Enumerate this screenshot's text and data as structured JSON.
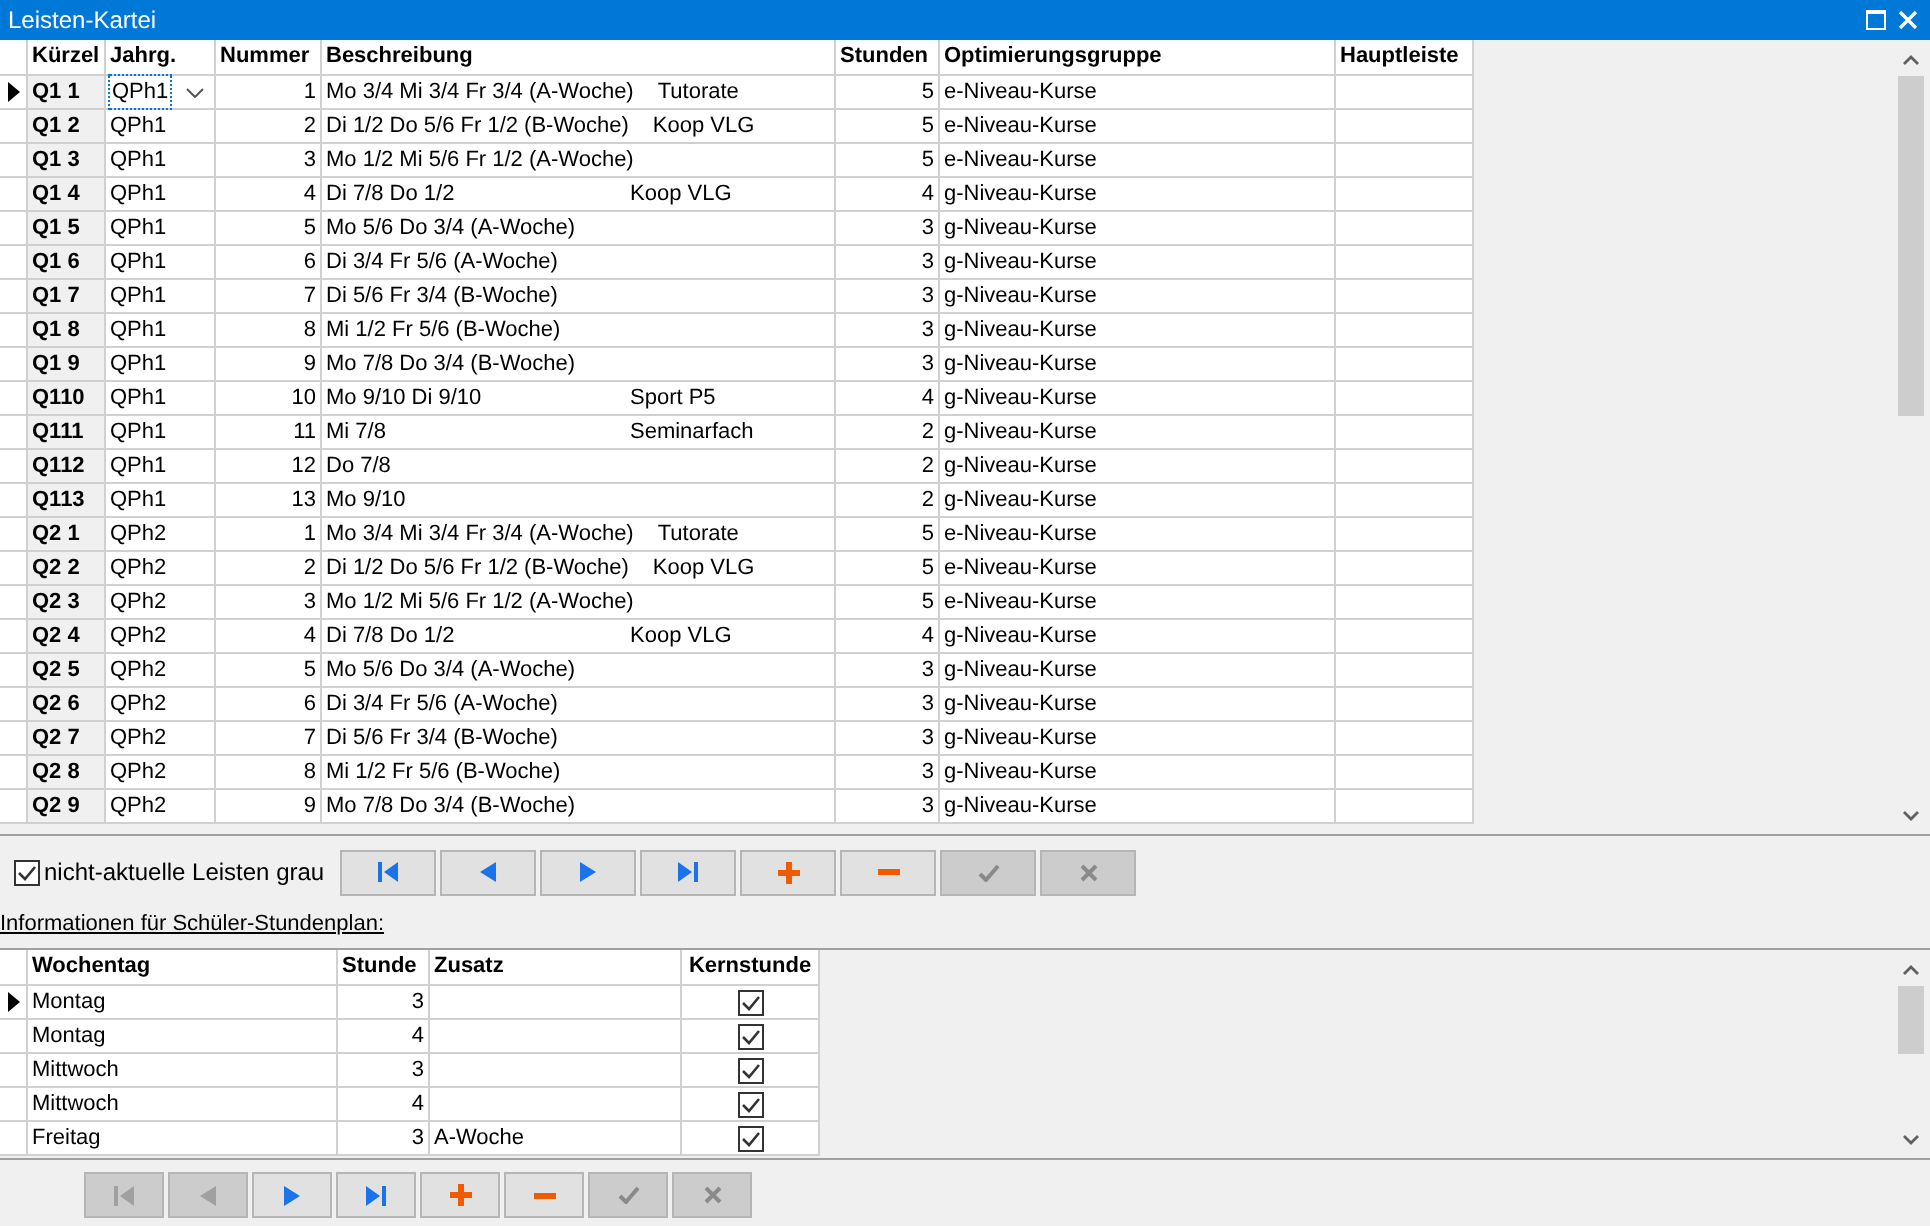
{
  "window": {
    "title": "Leisten-Kartei"
  },
  "leisten_table": {
    "columns": [
      "Kürzel",
      "Jahrg.",
      "Nummer",
      "Beschreibung",
      "Stunden",
      "Optimierungsgruppe",
      "Hauptleiste"
    ],
    "rows": [
      {
        "selected": true,
        "kuerzel": "Q1 1",
        "jahrg": "QPh1",
        "nummer": "1",
        "beschreibung": "Mo 3/4 Mi 3/4 Fr 3/4 (A-Woche)",
        "zusatz": "Tutorate",
        "stunden": "5",
        "gruppe": "e-Niveau-Kurse"
      },
      {
        "selected": false,
        "kuerzel": "Q1 2",
        "jahrg": "QPh1",
        "nummer": "2",
        "beschreibung": "Di 1/2 Do 5/6 Fr 1/2 (B-Woche)",
        "zusatz": "Koop VLG",
        "stunden": "5",
        "gruppe": "e-Niveau-Kurse"
      },
      {
        "selected": false,
        "kuerzel": "Q1 3",
        "jahrg": "QPh1",
        "nummer": "3",
        "beschreibung": "Mo 1/2 Mi 5/6 Fr 1/2 (A-Woche)",
        "stunden": "5",
        "gruppe": "e-Niveau-Kurse"
      },
      {
        "selected": false,
        "kuerzel": "Q1 4",
        "jahrg": "QPh1",
        "nummer": "4",
        "beschreibung": "Di 7/8 Do 1/2",
        "zusatz": "Koop VLG",
        "stunden": "4",
        "gruppe": "g-Niveau-Kurse"
      },
      {
        "selected": false,
        "kuerzel": "Q1 5",
        "jahrg": "QPh1",
        "nummer": "5",
        "beschreibung": "Mo 5/6 Do 3/4 (A-Woche)",
        "stunden": "3",
        "gruppe": "g-Niveau-Kurse"
      },
      {
        "selected": false,
        "kuerzel": "Q1 6",
        "jahrg": "QPh1",
        "nummer": "6",
        "beschreibung": "Di 3/4 Fr 5/6 (A-Woche)",
        "stunden": "3",
        "gruppe": "g-Niveau-Kurse"
      },
      {
        "selected": false,
        "kuerzel": "Q1 7",
        "jahrg": "QPh1",
        "nummer": "7",
        "beschreibung": "Di 5/6 Fr 3/4 (B-Woche)",
        "stunden": "3",
        "gruppe": "g-Niveau-Kurse"
      },
      {
        "selected": false,
        "kuerzel": "Q1 8",
        "jahrg": "QPh1",
        "nummer": "8",
        "beschreibung": "Mi 1/2 Fr 5/6 (B-Woche)",
        "stunden": "3",
        "gruppe": "g-Niveau-Kurse"
      },
      {
        "selected": false,
        "kuerzel": "Q1 9",
        "jahrg": "QPh1",
        "nummer": "9",
        "beschreibung": "Mo 7/8 Do 3/4 (B-Woche)",
        "stunden": "3",
        "gruppe": "g-Niveau-Kurse"
      },
      {
        "selected": false,
        "kuerzel": "Q110",
        "jahrg": "QPh1",
        "nummer": "10",
        "beschreibung": "Mo 9/10 Di 9/10",
        "zusatz": "Sport P5",
        "stunden": "4",
        "gruppe": "g-Niveau-Kurse"
      },
      {
        "selected": false,
        "kuerzel": "Q111",
        "jahrg": "QPh1",
        "nummer": "11",
        "beschreibung": "Mi 7/8",
        "zusatz": "Seminarfach",
        "stunden": "2",
        "gruppe": "g-Niveau-Kurse"
      },
      {
        "selected": false,
        "kuerzel": "Q112",
        "jahrg": "QPh1",
        "nummer": "12",
        "beschreibung": "Do 7/8",
        "stunden": "2",
        "gruppe": "g-Niveau-Kurse"
      },
      {
        "selected": false,
        "kuerzel": "Q113",
        "jahrg": "QPh1",
        "nummer": "13",
        "beschreibung": "Mo 9/10",
        "stunden": "2",
        "gruppe": "g-Niveau-Kurse"
      },
      {
        "selected": false,
        "kuerzel": "Q2 1",
        "jahrg": "QPh2",
        "nummer": "1",
        "beschreibung": "Mo 3/4 Mi 3/4 Fr 3/4 (A-Woche)",
        "zusatz": "Tutorate",
        "stunden": "5",
        "gruppe": "e-Niveau-Kurse"
      },
      {
        "selected": false,
        "kuerzel": "Q2 2",
        "jahrg": "QPh2",
        "nummer": "2",
        "beschreibung": "Di 1/2 Do 5/6 Fr 1/2 (B-Woche)",
        "zusatz": "Koop VLG",
        "stunden": "5",
        "gruppe": "e-Niveau-Kurse"
      },
      {
        "selected": false,
        "kuerzel": "Q2 3",
        "jahrg": "QPh2",
        "nummer": "3",
        "beschreibung": "Mo 1/2 Mi 5/6 Fr 1/2 (A-Woche)",
        "stunden": "5",
        "gruppe": "e-Niveau-Kurse"
      },
      {
        "selected": false,
        "kuerzel": "Q2 4",
        "jahrg": "QPh2",
        "nummer": "4",
        "beschreibung": "Di 7/8 Do 1/2",
        "zusatz": "Koop VLG",
        "stunden": "4",
        "gruppe": "g-Niveau-Kurse"
      },
      {
        "selected": false,
        "kuerzel": "Q2 5",
        "jahrg": "QPh2",
        "nummer": "5",
        "beschreibung": "Mo 5/6 Do 3/4 (A-Woche)",
        "stunden": "3",
        "gruppe": "g-Niveau-Kurse"
      },
      {
        "selected": false,
        "kuerzel": "Q2 6",
        "jahrg": "QPh2",
        "nummer": "6",
        "beschreibung": "Di 3/4 Fr 5/6 (A-Woche)",
        "stunden": "3",
        "gruppe": "g-Niveau-Kurse"
      },
      {
        "selected": false,
        "kuerzel": "Q2 7",
        "jahrg": "QPh2",
        "nummer": "7",
        "beschreibung": "Di 5/6 Fr 3/4 (B-Woche)",
        "stunden": "3",
        "gruppe": "g-Niveau-Kurse"
      },
      {
        "selected": false,
        "kuerzel": "Q2 8",
        "jahrg": "QPh2",
        "nummer": "8",
        "beschreibung": "Mi 1/2 Fr 5/6 (B-Woche)",
        "stunden": "3",
        "gruppe": "g-Niveau-Kurse"
      },
      {
        "selected": false,
        "kuerzel": "Q2 9",
        "jahrg": "QPh2",
        "nummer": "9",
        "beschreibung": "Mo 7/8 Do 3/4 (B-Woche)",
        "stunden": "3",
        "gruppe": "g-Niveau-Kurse"
      }
    ]
  },
  "grey_option": {
    "label": "nicht-aktuelle Leisten grau",
    "checked": true
  },
  "leisten_nav": [
    {
      "kind": "first",
      "disabled": false
    },
    {
      "kind": "prior",
      "disabled": false
    },
    {
      "kind": "next",
      "disabled": false
    },
    {
      "kind": "last",
      "disabled": false
    },
    {
      "kind": "insert",
      "disabled": false
    },
    {
      "kind": "delete",
      "disabled": false
    },
    {
      "kind": "post",
      "disabled": true
    },
    {
      "kind": "cancel",
      "disabled": true
    }
  ],
  "info_label": "Informationen für Schüler-Stundenplan:",
  "stunden_table": {
    "columns": [
      "Wochentag",
      "Stunde",
      "Zusatz",
      "Kernstunde"
    ],
    "rows": [
      {
        "selected": true,
        "wochentag": "Montag",
        "stunde": "3",
        "kernstunde": true
      },
      {
        "selected": false,
        "wochentag": "Montag",
        "stunde": "4",
        "kernstunde": true
      },
      {
        "selected": false,
        "wochentag": "Mittwoch",
        "stunde": "3",
        "kernstunde": true
      },
      {
        "selected": false,
        "wochentag": "Mittwoch",
        "stunde": "4",
        "kernstunde": true
      },
      {
        "selected": false,
        "wochentag": "Freitag",
        "stunde": "3",
        "zusatz": "A-Woche",
        "kernstunde": true
      }
    ]
  },
  "stunden_nav": [
    {
      "kind": "first",
      "disabled": true
    },
    {
      "kind": "prior",
      "disabled": true
    },
    {
      "kind": "next",
      "disabled": false
    },
    {
      "kind": "last",
      "disabled": false
    },
    {
      "kind": "insert",
      "disabled": false
    },
    {
      "kind": "delete",
      "disabled": false
    },
    {
      "kind": "post",
      "disabled": true
    },
    {
      "kind": "cancel",
      "disabled": true
    }
  ]
}
